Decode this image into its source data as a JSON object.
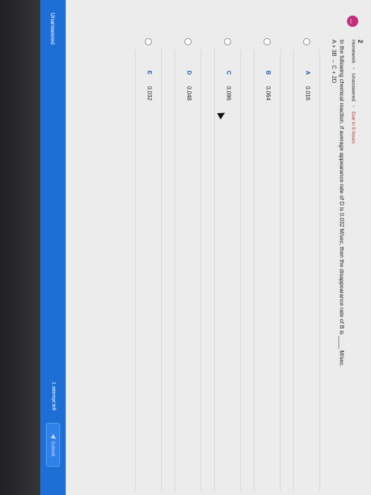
{
  "question": {
    "number": "2",
    "category": "Homework",
    "status": "Unanswered",
    "due": "Due in 5 hours",
    "text": "In the following chemical reaction, if average appearance rate of D is 0.032 M/sec, then the disappearance rate of B is ____ M/sec.",
    "reaction": "A + 3B → C + 2D",
    "avatar_label": "..."
  },
  "options": [
    {
      "letter": "A",
      "value": "0.016"
    },
    {
      "letter": "B",
      "value": "0.064"
    },
    {
      "letter": "C",
      "value": "0.096"
    },
    {
      "letter": "D",
      "value": "0.048"
    },
    {
      "letter": "E",
      "value": "0.032"
    }
  ],
  "footer": {
    "status": "Unanswered",
    "attempts": "1 attempt left",
    "submit_label": "Submit",
    "submit_icon": "send-icon"
  },
  "colors": {
    "accent": "#1d6fd6",
    "avatar": "#c2307a",
    "option_letter": "#1a5fb4",
    "due": "#c0392b"
  }
}
